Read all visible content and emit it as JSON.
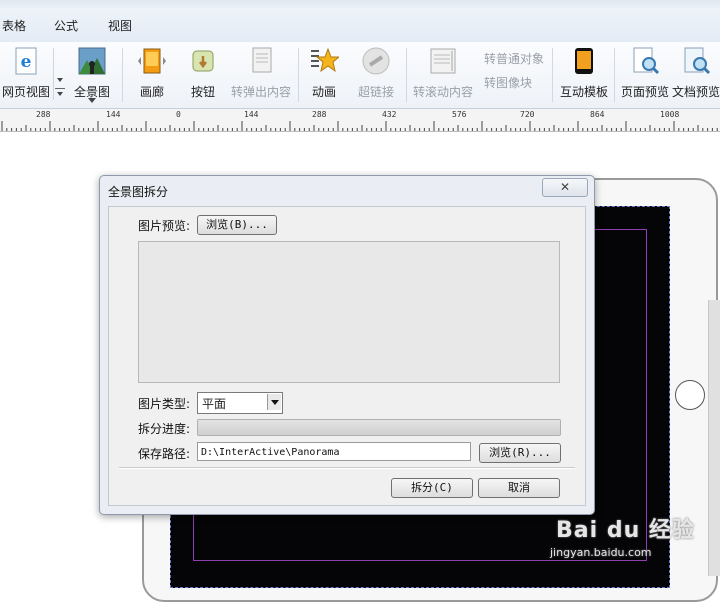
{
  "menubar": {
    "items": [
      "表格",
      "公式",
      "视图"
    ]
  },
  "ribbon": {
    "buttons": [
      {
        "label": "网页视图",
        "icon": "ie-page-view-icon",
        "enabled": true
      },
      {
        "label": "全景图",
        "icon": "panorama-icon",
        "enabled": true
      },
      {
        "label": "画廊",
        "icon": "gallery-icon",
        "enabled": true
      },
      {
        "label": "按钮",
        "icon": "button-icon",
        "enabled": true
      },
      {
        "label": "转弹出内容",
        "icon": "popup-content-icon",
        "enabled": false
      },
      {
        "label": "动画",
        "icon": "animation-star-icon",
        "enabled": true
      },
      {
        "label": "超链接",
        "icon": "hyperlink-icon",
        "enabled": false
      },
      {
        "label": "转滚动内容",
        "icon": "scroll-content-icon",
        "enabled": false
      },
      {
        "label": "互动模板",
        "icon": "interactive-template-icon",
        "enabled": true
      },
      {
        "label": "页面预览",
        "icon": "page-preview-icon",
        "enabled": true
      },
      {
        "label": "文档预览",
        "icon": "doc-preview-icon",
        "enabled": true
      }
    ],
    "small_buttons": [
      "转普通对象",
      "转图像块"
    ]
  },
  "ruler": {
    "labels": [
      "288",
      "144",
      "0",
      "144",
      "288",
      "432",
      "576",
      "720",
      "864",
      "1008"
    ]
  },
  "dialog": {
    "title": "全景图拆分",
    "close": "✕",
    "preview_label": "图片预览:",
    "browse_preview": "浏览(B)...",
    "type_label": "图片类型:",
    "type_value": "平面",
    "progress_label": "拆分进度:",
    "progress": 0,
    "save_label": "保存路径:",
    "save_path": "D:\\InterActive\\Panorama",
    "browse_save": "浏览(R)...",
    "split_button": "拆分(C)",
    "cancel_button": "取消"
  },
  "watermark": {
    "brand": "Bai du 经验",
    "url": "jingyan.baidu.com"
  },
  "colors": {
    "ribbon_bg": "#eef2f7",
    "dialog_bg": "#eaeef4",
    "screen_bg": "#050507"
  }
}
